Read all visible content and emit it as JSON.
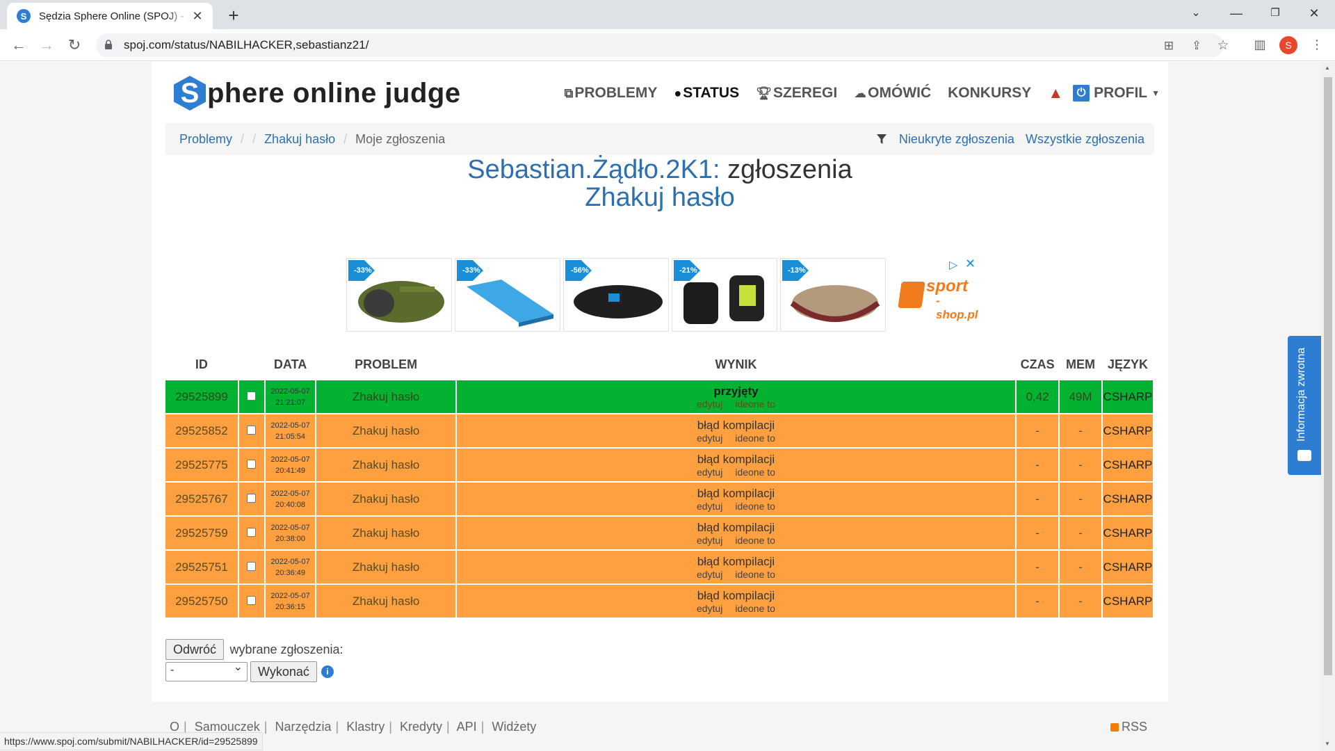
{
  "browser": {
    "tab_title": "Sędzia Sphere Online (SPOJ) - Status",
    "tab_favicon": "S",
    "url": "spoj.com/status/NABILHACKER,sebastianz21/",
    "profile_initial": "S",
    "status_url": "https://www.spoj.com/submit/NABILHACKER/id=29525899"
  },
  "site": {
    "brand_letter": "S",
    "brand_text": "phere online judge",
    "nav": {
      "problems": "PROBLEMY",
      "status": "STATUS",
      "ranks": "SZEREGI",
      "discuss": "OMÓWIĆ",
      "contests": "KONKURSY",
      "profile": "PROFIL"
    }
  },
  "breadcrumb": {
    "problems": "Problemy",
    "problem": "Zhakuj hasło",
    "current": "Moje zgłoszenia",
    "unhidden": "Nieukryte zgłoszenia",
    "all": "Wszystkie zgłoszenia"
  },
  "heading": {
    "user": "Sebastian.Żądło.2K1:",
    "suffix": "zgłoszenia",
    "problem": "Zhakuj hasło"
  },
  "ads": {
    "badges": [
      "-33%",
      "-33%",
      "-56%",
      "-21%",
      "-13%"
    ],
    "logo_text": "sport",
    "logo_sub": "-shop.pl"
  },
  "table": {
    "headers": {
      "id": "ID",
      "date": "DATA",
      "problem": "PROBLEM",
      "result": "WYNIK",
      "time": "CZAS",
      "mem": "MEM",
      "lang": "JĘZYK"
    },
    "edit_label": "edytuj",
    "ideone_label": "ideone to",
    "rows": [
      {
        "id": "29525899",
        "date": "2022-05-07",
        "time_of_day": "21:21:07",
        "problem": "Zhakuj hasło",
        "status": "przyjęty",
        "time": "0,42",
        "mem": "49M",
        "lang": "CSHARP"
      },
      {
        "id": "29525852",
        "date": "2022-05-07",
        "time_of_day": "21:05:54",
        "problem": "Zhakuj hasło",
        "status": "błąd kompilacji",
        "time": "-",
        "mem": "-",
        "lang": "CSHARP"
      },
      {
        "id": "29525775",
        "date": "2022-05-07",
        "time_of_day": "20:41:49",
        "problem": "Zhakuj hasło",
        "status": "błąd kompilacji",
        "time": "-",
        "mem": "-",
        "lang": "CSHARP"
      },
      {
        "id": "29525767",
        "date": "2022-05-07",
        "time_of_day": "20:40:08",
        "problem": "Zhakuj hasło",
        "status": "błąd kompilacji",
        "time": "-",
        "mem": "-",
        "lang": "CSHARP"
      },
      {
        "id": "29525759",
        "date": "2022-05-07",
        "time_of_day": "20:38:00",
        "problem": "Zhakuj hasło",
        "status": "błąd kompilacji",
        "time": "-",
        "mem": "-",
        "lang": "CSHARP"
      },
      {
        "id": "29525751",
        "date": "2022-05-07",
        "time_of_day": "20:36:49",
        "problem": "Zhakuj hasło",
        "status": "błąd kompilacji",
        "time": "-",
        "mem": "-",
        "lang": "CSHARP"
      },
      {
        "id": "29525750",
        "date": "2022-05-07",
        "time_of_day": "20:36:15",
        "problem": "Zhakuj hasło",
        "status": "błąd kompilacji",
        "time": "-",
        "mem": "-",
        "lang": "CSHARP"
      }
    ]
  },
  "bulk": {
    "invert_button": "Odwróć",
    "label": "wybrane zgłoszenia:",
    "select_value": "-",
    "execute_button": "Wykonać",
    "info_icon": "i"
  },
  "footer": {
    "links": [
      "O",
      "Samouczek",
      "Narzędzia",
      "Klastry",
      "Kredyty",
      "API",
      "Widżety"
    ],
    "rss": "RSS"
  },
  "feedback": {
    "label": "Informacja zwrotna"
  },
  "colors": {
    "accepted": "#02b230",
    "compile_error": "#ffa040",
    "link": "#2d6fb0",
    "brand": "#2d7dd2"
  }
}
